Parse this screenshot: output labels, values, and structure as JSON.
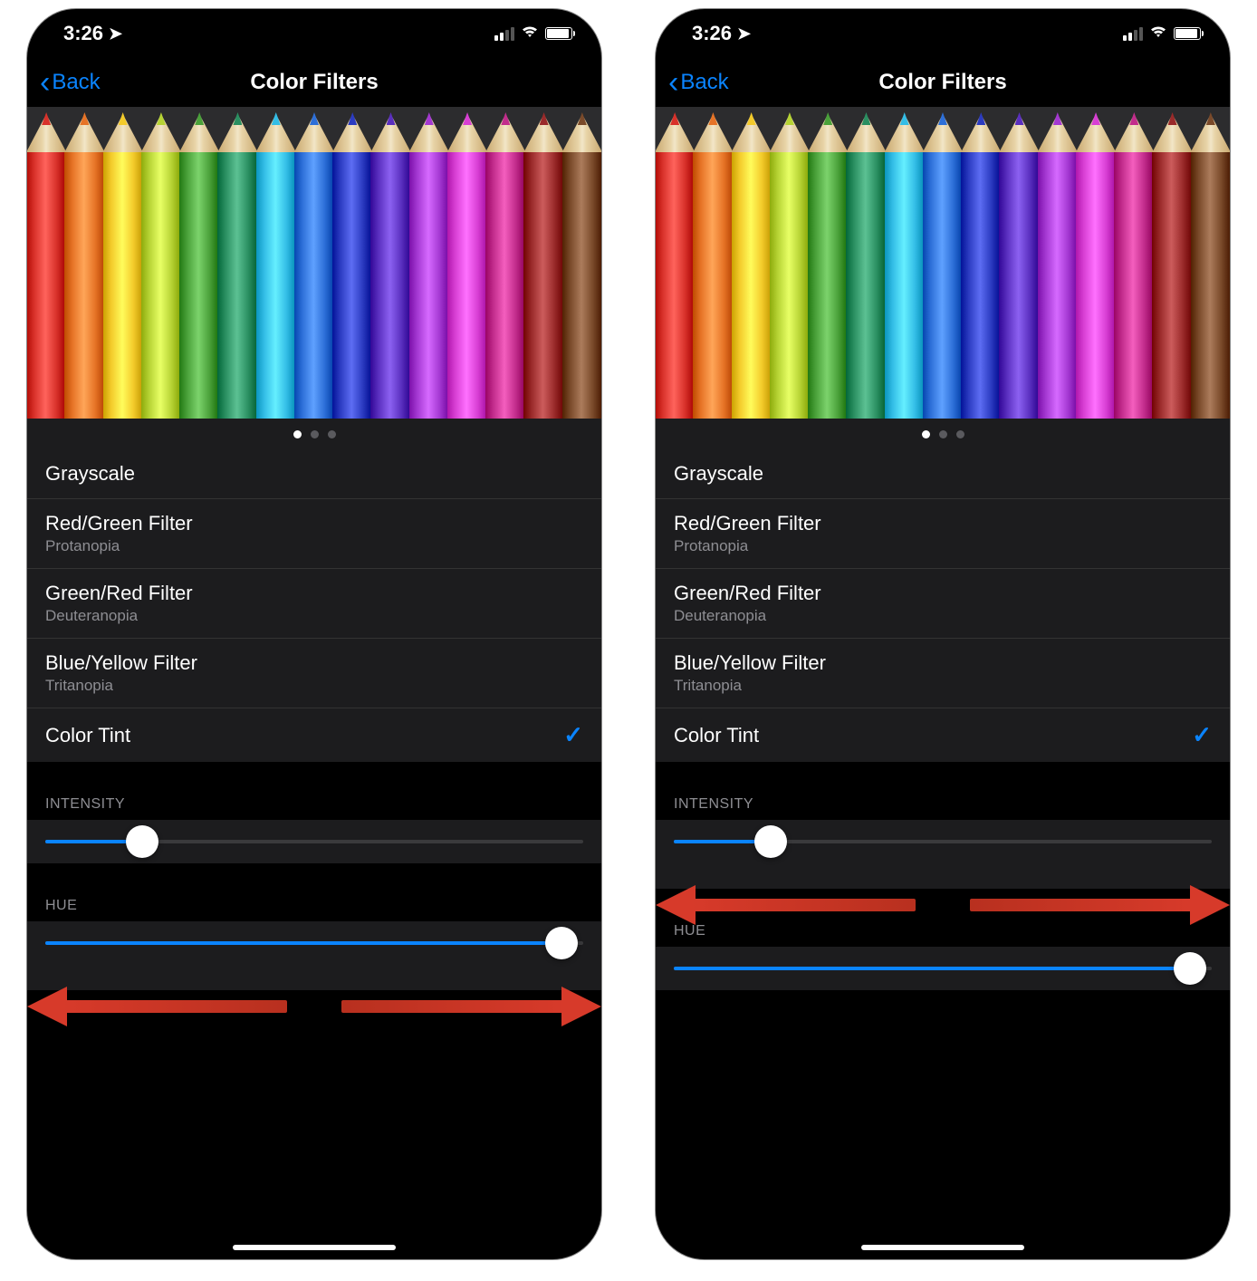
{
  "status": {
    "time": "3:26"
  },
  "nav": {
    "back": "Back",
    "title": "Color Filters"
  },
  "pencil_colors": [
    "#d8312a",
    "#e67326",
    "#f3ca2a",
    "#b6d334",
    "#4aa13a",
    "#2a8f61",
    "#33bde6",
    "#2d6fd8",
    "#2b3bc1",
    "#5a2fbf",
    "#a438d2",
    "#d83fd4",
    "#c22c8c",
    "#9a2a2a",
    "#7a4a2a"
  ],
  "filters": [
    {
      "primary": "Grayscale",
      "secondary": ""
    },
    {
      "primary": "Red/Green Filter",
      "secondary": "Protanopia"
    },
    {
      "primary": "Green/Red Filter",
      "secondary": "Deuteranopia"
    },
    {
      "primary": "Blue/Yellow Filter",
      "secondary": "Tritanopia"
    },
    {
      "primary": "Color Tint",
      "secondary": "",
      "checked": true
    }
  ],
  "sections": {
    "intensity": "INTENSITY",
    "hue": "HUE"
  },
  "screens": [
    {
      "intensity_pct": 18,
      "hue_pct": 96,
      "arrows_on": "hue"
    },
    {
      "intensity_pct": 18,
      "hue_pct": 96,
      "arrows_on": "intensity"
    }
  ]
}
